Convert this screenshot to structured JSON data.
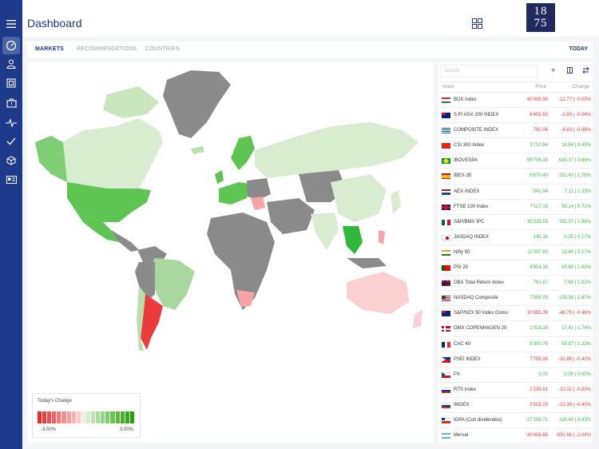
{
  "app": {
    "title": "Dashboard",
    "logo_top": "18",
    "logo_bottom": "75"
  },
  "colors": {
    "brand": "#1e3a8a",
    "positive": "#3bbd4a",
    "negative": "#ec3b3b"
  },
  "sidebar": {
    "icons": [
      "menu-icon",
      "dashboard-gauge-icon",
      "user-icon",
      "portfolio-icon",
      "briefcase-icon",
      "activity-pulse-icon",
      "checkmark-icon",
      "cube-icon",
      "id-card-icon"
    ]
  },
  "tabs": [
    {
      "label": "MARKETS",
      "active": true
    },
    {
      "label": "RECOMMENDATIONS",
      "active": false
    },
    {
      "label": "COUNTRIES",
      "active": false
    }
  ],
  "period": "TODAY",
  "legend": {
    "title": "Today's Change",
    "min": "-3.00%",
    "max": "3.00%"
  },
  "list": {
    "search_placeholder": "Search",
    "headers": {
      "index": "Index",
      "price": "Price",
      "change": "Change"
    },
    "rows": [
      {
        "flag": "HU",
        "name": "BUX Index",
        "price": "40'005.90",
        "change": "-12.77 | -0.03%",
        "dir": "neg"
      },
      {
        "flag": "AU",
        "name": "S P/ ASX 200 INDEX",
        "price": "6'405.50",
        "change": "-2.60 | -0.04%",
        "dir": "neg"
      },
      {
        "flag": "GR",
        "name": "COMPOSITE INDEX",
        "price": "792.06",
        "change": "-6.83 | -0.86%",
        "dir": "neg"
      },
      {
        "flag": "CN",
        "name": "CSI 300 Index",
        "price": "3'710.54",
        "change": "16.54 | 0.45%",
        "dir": "pos"
      },
      {
        "flag": "BR",
        "name": "IBOVESPA",
        "price": "99'706.28",
        "change": "649.37 | 0.66%",
        "dir": "pos"
      },
      {
        "flag": "ES",
        "name": "IBEX-35",
        "price": "8'670.40",
        "change": "151.40 | 1.78%",
        "dir": "pos"
      },
      {
        "flag": "NL",
        "name": "AEX-INDEX",
        "price": "541.94",
        "change": "7.11 | 1.33%",
        "dir": "pos"
      },
      {
        "flag": "GB",
        "name": "FTSE 100 Index",
        "price": "7'117.15",
        "change": "50.14 | 0.71%",
        "dir": "pos"
      },
      {
        "flag": "MX",
        "name": "S&P/BMV IPC",
        "price": "39'339.55",
        "change": "765.37 | 1.98%",
        "dir": "pos"
      },
      {
        "flag": "JP",
        "name": "JASDAQ INDEX",
        "price": "145.36",
        "change": "0.25 | 0.17%",
        "dir": "pos"
      },
      {
        "flag": "IN",
        "name": "Nifty 50",
        "price": "11'047.80",
        "change": "18.40 | 0.17%",
        "dir": "pos"
      },
      {
        "flag": "PT",
        "name": "PSI 20",
        "price": "4'804.19",
        "change": "85.90 | 1.82%",
        "dir": "pos"
      },
      {
        "flag": "NO",
        "name": "OBX Total Return Index",
        "price": "761.87",
        "change": "7.68 | 1.02%",
        "dir": "pos"
      },
      {
        "flag": "US",
        "name": "NASDAQ Composite",
        "price": "7'895.99",
        "change": "129.38 | 1.67%",
        "dir": "pos"
      },
      {
        "flag": "NZ",
        "name": "S&P/NZX 50 Index Gross",
        "price": "10'655.36",
        "change": "-48.75 | -0.46%",
        "dir": "neg"
      },
      {
        "flag": "DK",
        "name": "OMX COPENHAGEN 20",
        "price": "1'018.39",
        "change": "17.41 | 1.74%",
        "dir": "pos"
      },
      {
        "flag": "FR",
        "name": "CAC 40",
        "price": "5'300.79",
        "change": "63.87 | 1.22%",
        "dir": "pos"
      },
      {
        "flag": "PH",
        "name": "PSEI INDEX",
        "price": "7'795.98",
        "change": "-32.88 | -0.42%",
        "dir": "neg"
      },
      {
        "flag": "CZ",
        "name": "PX",
        "price": "0.00",
        "change": "0.00 | 0.00%",
        "dir": "pos"
      },
      {
        "flag": "RU",
        "name": "RTS Index",
        "price": "1'239.81",
        "change": "-10.32 | -0.83%",
        "dir": "neg"
      },
      {
        "flag": "RU",
        "name": "IMOEX",
        "price": "2'615.20",
        "change": "-10.38 | -0.40%",
        "dir": "neg"
      },
      {
        "flag": "CL",
        "name": "IGPA (Con dividendos)",
        "price": "27'256.71",
        "change": "116.40 | 0.43%",
        "dir": "pos"
      },
      {
        "flag": "AR",
        "name": "Merval",
        "price": "30'406.65",
        "change": "-632.66 | -2.04%",
        "dir": "neg"
      }
    ]
  }
}
